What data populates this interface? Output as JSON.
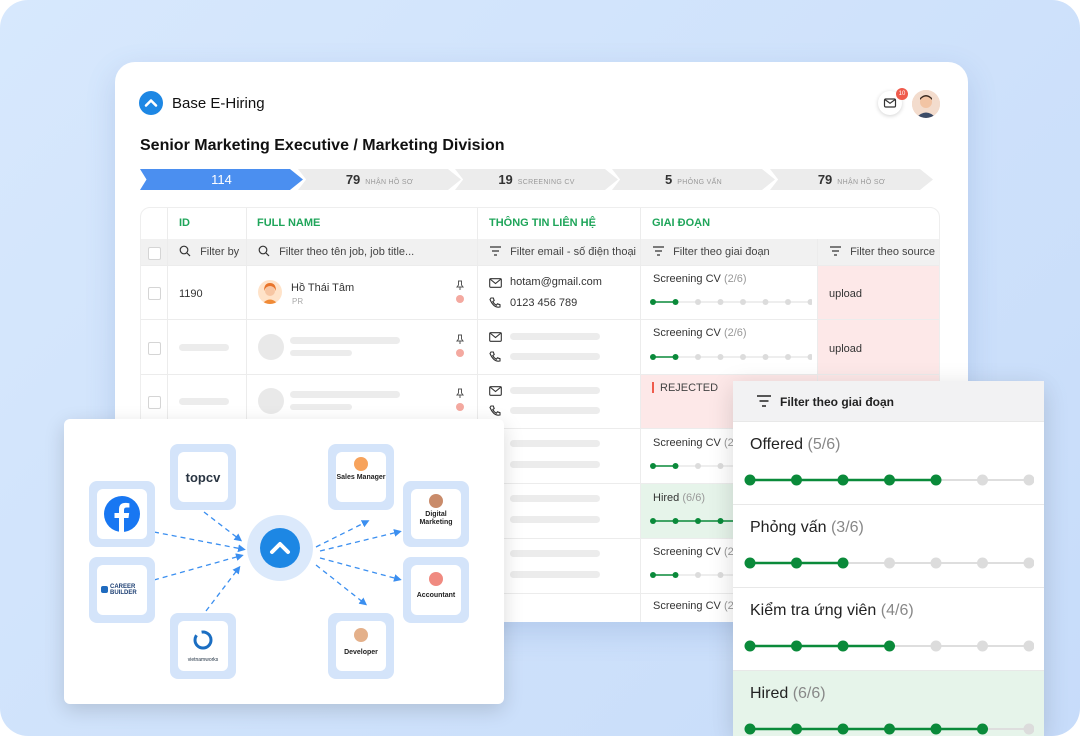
{
  "app": {
    "name": "Base E-Hiring",
    "notification_count": "10"
  },
  "job": {
    "title": "Senior Marketing Executive / Marketing Division"
  },
  "pipeline": [
    {
      "count": "114",
      "label": ""
    },
    {
      "count": "79",
      "label": "NHẬN HỒ SƠ"
    },
    {
      "count": "19",
      "label": "SCREENING CV"
    },
    {
      "count": "5",
      "label": "PHỎNG VẤN"
    },
    {
      "count": "79",
      "label": "NHẬN HỒ SƠ"
    }
  ],
  "table": {
    "headers": {
      "id": "ID",
      "full_name": "FULL NAME",
      "contact": "THÔNG TIN LIÊN HỆ",
      "stage": "GIAI ĐOẠN"
    },
    "filters": {
      "id": "Filter by",
      "name": "Filter theo tên job, job title...",
      "contact": "Filter email - số điện thoại",
      "stage": "Filter theo giai đoạn",
      "source": "Filter theo source"
    },
    "row1": {
      "id": "1190",
      "name": "Hồ Thái Tâm",
      "role": "PR",
      "email": "hotam@gmail.com",
      "phone": "0123 456 789",
      "stage": "Screening CV",
      "stage_count": "(2/6)",
      "source": "upload"
    },
    "row2": {
      "stage": "Screening CV",
      "stage_count": "(2/6)",
      "source": "upload"
    },
    "row3": {
      "stage": "REJECTED"
    },
    "row4": {
      "stage": "Screening CV",
      "stage_count": "(2/6)"
    },
    "row5": {
      "stage": "Hired",
      "stage_count": "(6/6)"
    },
    "row6": {
      "stage": "Screening CV",
      "stage_count": "(2/6)"
    },
    "row7": {
      "stage": "Screening CV",
      "stage_count": "(2/6)"
    }
  },
  "stage_panel": {
    "title": "Filter theo giai đoạn",
    "stages": [
      {
        "name": "Offered",
        "count": "(5/6)",
        "progress": 5
      },
      {
        "name": "Phỏng vấn",
        "count": "(3/6)",
        "progress": 3
      },
      {
        "name": "Kiểm tra ứng viên",
        "count": "(4/6)",
        "progress": 4
      },
      {
        "name": "Hired",
        "count": "(6/6)",
        "progress": 6
      }
    ]
  },
  "integrations": {
    "sources": {
      "topcv": "topcv",
      "careerbuilder": "CAREER BUILDER",
      "vietnamworks": "vietnamworks"
    },
    "roles": {
      "sales": "Sales Manager",
      "digital": "Digital Marketing",
      "accountant": "Accountant",
      "developer": "Developer"
    }
  },
  "colors": {
    "accent": "#1d87e4",
    "green": "#1fa55a",
    "progress_green": "#0a8a3a",
    "rejected": "#ef5b4c"
  }
}
